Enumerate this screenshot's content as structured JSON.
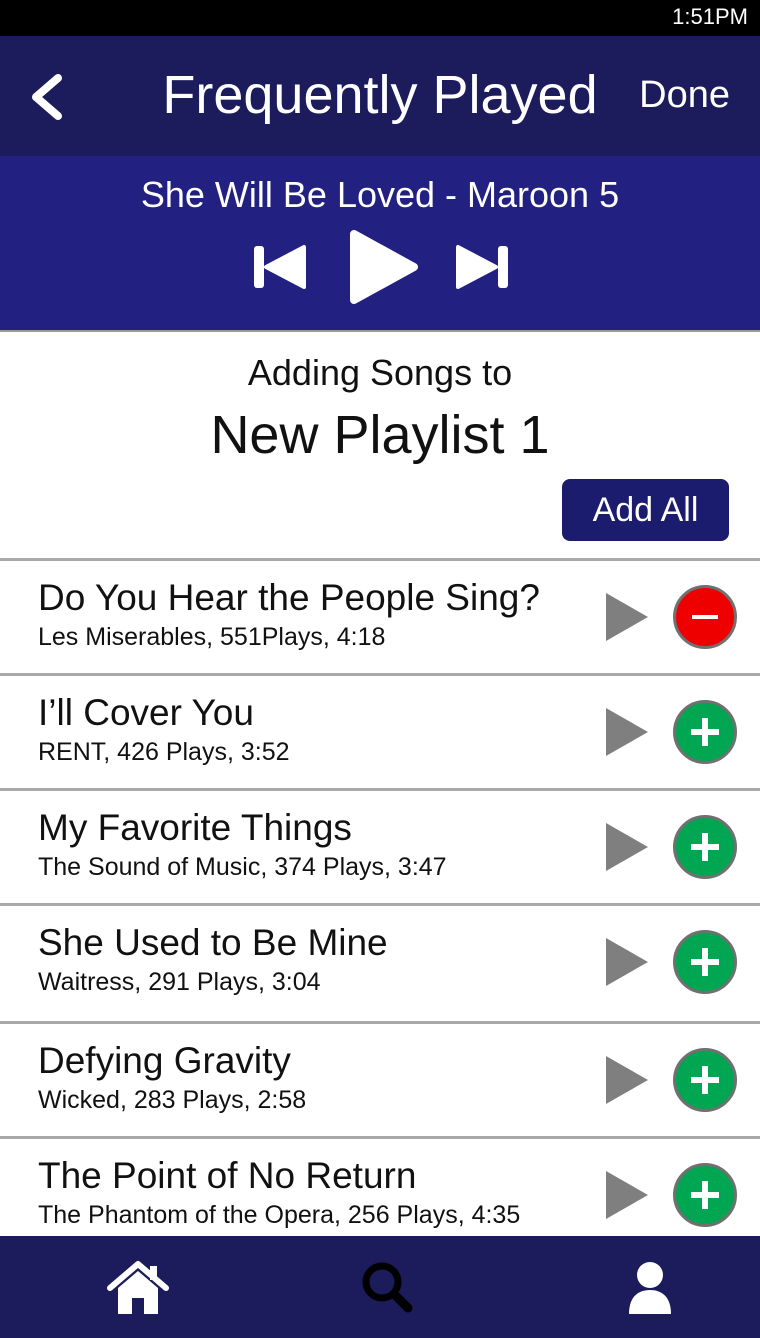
{
  "status_bar": {
    "time": "1:51PM"
  },
  "header": {
    "title": "Frequently Played",
    "done_label": "Done",
    "back_icon": "chevron-left-icon"
  },
  "player": {
    "now_playing": "She Will Be Loved - Maroon 5",
    "controls": [
      "skip-previous-icon",
      "play-icon",
      "skip-next-icon"
    ]
  },
  "playlist": {
    "adding_label": "Adding Songs to",
    "name": "New Playlist 1",
    "add_all_label": "Add All"
  },
  "songs": [
    {
      "title": "Do You Hear the People Sing?",
      "meta": "Les Miserables, 551Plays, 4:18",
      "action": "remove"
    },
    {
      "title": "I’ll Cover You",
      "meta": "RENT, 426 Plays, 3:52",
      "action": "add"
    },
    {
      "title": "My Favorite Things",
      "meta": "The Sound of Music, 374 Plays, 3:47",
      "action": "add"
    },
    {
      "title": "She Used to Be Mine",
      "meta": "Waitress, 291 Plays, 3:04",
      "action": "add"
    },
    {
      "title": "Defying Gravity",
      "meta": "Wicked, 283 Plays, 2:58",
      "action": "add"
    },
    {
      "title": "The Point of No Return",
      "meta": "The Phantom of the Opera, 256 Plays, 4:35",
      "action": "add"
    }
  ],
  "tab_bar": {
    "tabs": [
      "home-icon",
      "search-icon",
      "profile-icon"
    ]
  },
  "colors": {
    "header_bg": "#1c1c5c",
    "player_bg": "#222080",
    "add_green": "#00a651",
    "remove_red": "#ee0000",
    "row_play_gray": "#7f7f7f"
  }
}
